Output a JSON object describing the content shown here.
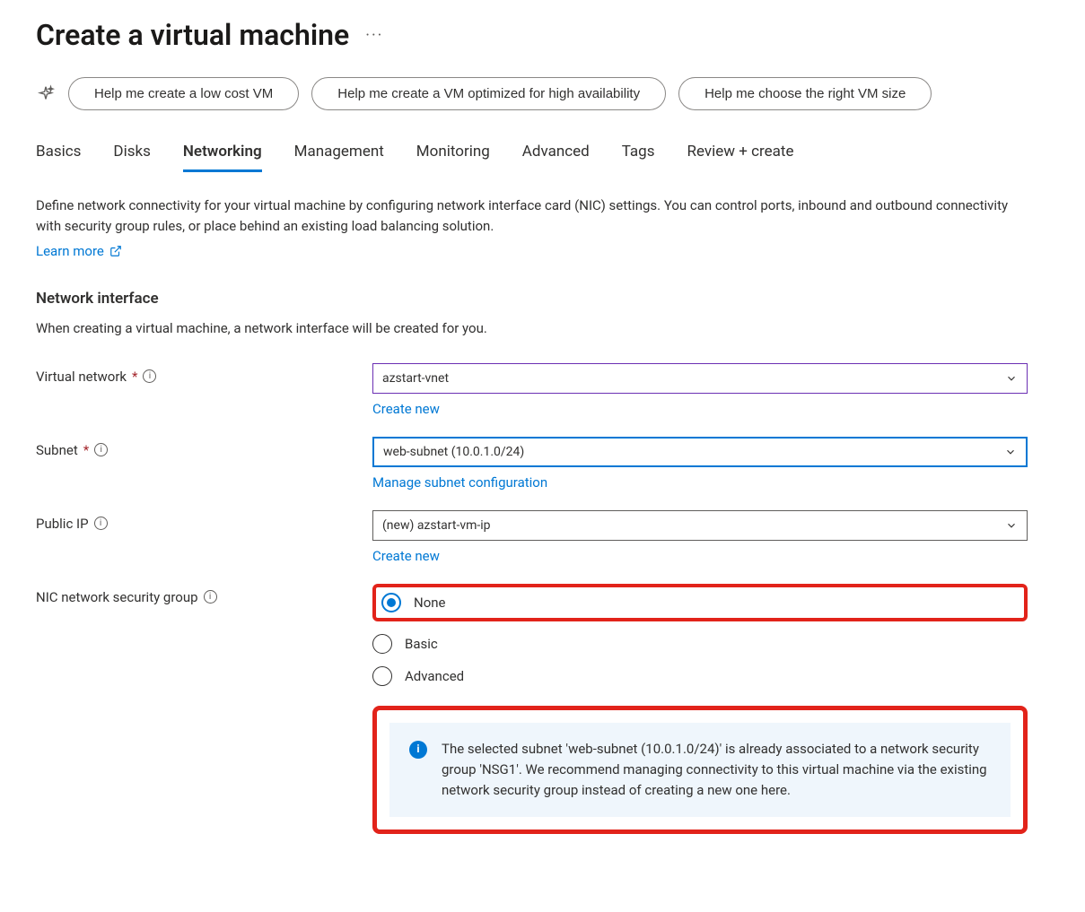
{
  "page": {
    "title": "Create a virtual machine"
  },
  "suggestions": {
    "low_cost": "Help me create a low cost VM",
    "ha": "Help me create a VM optimized for high availability",
    "size": "Help me choose the right VM size"
  },
  "tabs": {
    "basics": "Basics",
    "disks": "Disks",
    "networking": "Networking",
    "management": "Management",
    "monitoring": "Monitoring",
    "advanced": "Advanced",
    "tags": "Tags",
    "review": "Review + create"
  },
  "networking": {
    "description": "Define network connectivity for your virtual machine by configuring network interface card (NIC) settings. You can control ports, inbound and outbound connectivity with security group rules, or place behind an existing load balancing solution.",
    "learn_more": "Learn more",
    "section_title": "Network interface",
    "section_subtext": "When creating a virtual machine, a network interface will be created for you."
  },
  "fields": {
    "vnet": {
      "label": "Virtual network",
      "value": "azstart-vnet",
      "create_new": "Create new"
    },
    "subnet": {
      "label": "Subnet",
      "value": "web-subnet (10.0.1.0/24)",
      "manage": "Manage subnet configuration"
    },
    "public_ip": {
      "label": "Public IP",
      "value": "(new) azstart-vm-ip",
      "create_new": "Create new"
    },
    "nsg": {
      "label": "NIC network security group",
      "options": {
        "none": "None",
        "basic": "Basic",
        "advanced": "Advanced"
      },
      "info": "The selected subnet 'web-subnet (10.0.1.0/24)' is already associated to a network security group 'NSG1'. We recommend managing connectivity to this virtual machine via the existing network security group instead of creating a new one here."
    }
  }
}
